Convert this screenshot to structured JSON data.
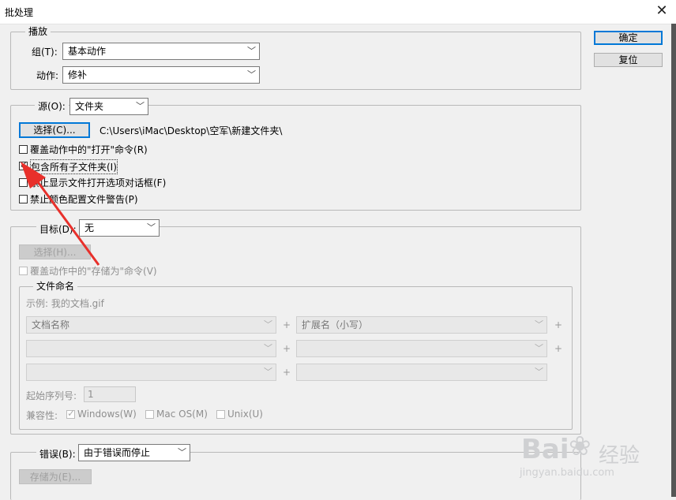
{
  "window": {
    "title": "批处理",
    "close_glyph": "✕"
  },
  "buttons": {
    "ok": "确定",
    "reset": "复位"
  },
  "play": {
    "legend": "播放",
    "set_label": "组(T):",
    "set_value": "基本动作",
    "action_label": "动作:",
    "action_value": "修补"
  },
  "source": {
    "label": "源(O):",
    "value": "文件夹",
    "choose_btn": "选择(C)...",
    "path": "C:\\Users\\iMac\\Desktop\\空军\\新建文件夹\\",
    "options": [
      {
        "label": "覆盖动作中的\"打开\"命令(R)",
        "checked": false
      },
      {
        "label": "包含所有子文件夹(I)",
        "checked": true
      },
      {
        "label": "禁止显示文件打开选项对话框(F)",
        "checked": false
      },
      {
        "label": "禁止颜色配置文件警告(P)",
        "checked": false
      }
    ]
  },
  "destination": {
    "label": "目标(D):",
    "value": "无",
    "choose_btn": "选择(H)...",
    "override_save": "覆盖动作中的\"存储为\"命令(V)",
    "naming": {
      "legend": "文件命名",
      "example": "示例: 我的文档.gif",
      "rows": [
        {
          "left": "文档名称",
          "right": "扩展名（小写）"
        },
        {
          "left": "",
          "right": ""
        },
        {
          "left": "",
          "right": ""
        }
      ],
      "plus": "+",
      "start_serial_label": "起始序列号:",
      "start_serial_value": "1",
      "compat_label": "兼容性:",
      "compat": [
        {
          "label": "Windows(W)",
          "checked": true
        },
        {
          "label": "Mac OS(M)",
          "checked": false
        },
        {
          "label": "Unix(U)",
          "checked": false
        }
      ]
    }
  },
  "errors": {
    "label": "错误(B):",
    "value": "由于错误而停止",
    "save_btn": "存储为(E)..."
  },
  "watermark": {
    "brand": "Bai",
    "brand2": "经验",
    "url": "jingyan.baidu.com"
  },
  "colors": {
    "annotation_arrow": "#e8302b",
    "default_button_border": "#0078d7"
  }
}
